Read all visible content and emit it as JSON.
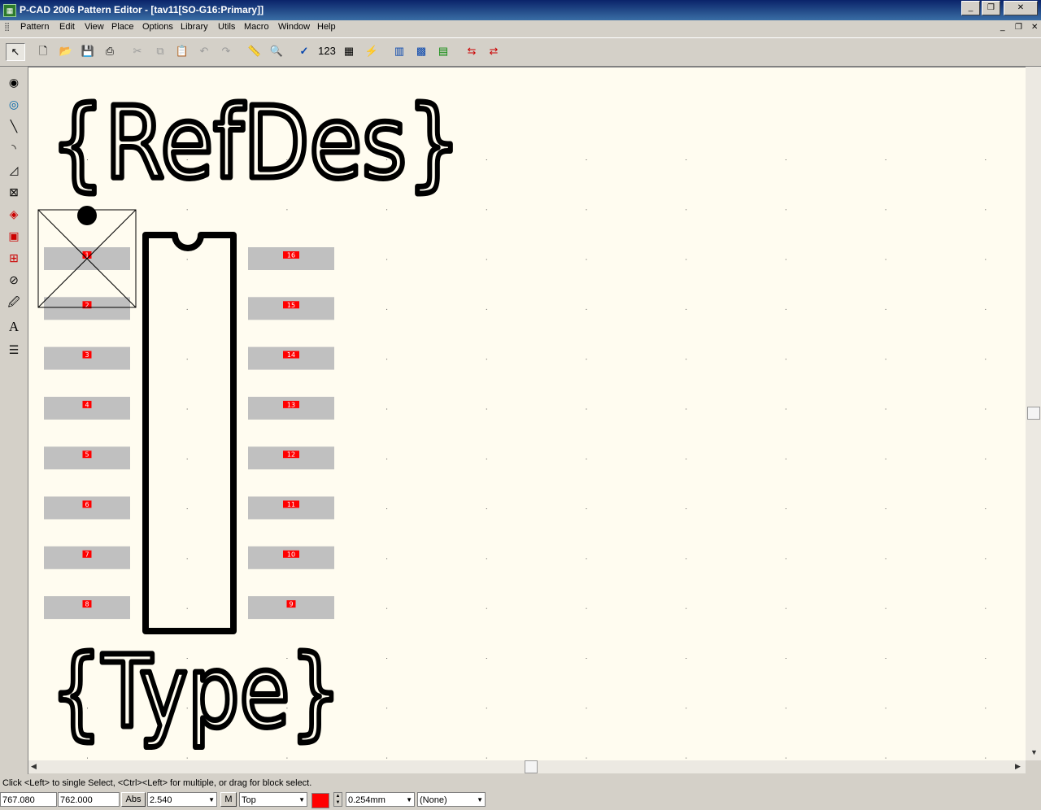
{
  "window": {
    "title": "P-CAD 2006 Pattern Editor - [tav11[SO-G16:Primary]]",
    "app_icon": "pcad-chip-icon",
    "minimize": "_",
    "restore": "❐",
    "close": "✕"
  },
  "menu": {
    "items": [
      "Pattern",
      "Edit",
      "View",
      "Place",
      "Options",
      "Library",
      "Utils",
      "Macro",
      "Window",
      "Help"
    ]
  },
  "mdi": {
    "minimize": "_",
    "restore": "❐",
    "close": "✕"
  },
  "toolbar": {
    "buttons": [
      {
        "icon": "select-arrow-icon",
        "glyph": "↖"
      },
      {
        "icon": "new-file-icon",
        "glyph": "🗋"
      },
      {
        "icon": "open-folder-icon",
        "glyph": "📂"
      },
      {
        "icon": "save-icon",
        "glyph": "💾"
      },
      {
        "icon": "print-icon",
        "glyph": "⎙"
      },
      {
        "icon": "cut-icon",
        "glyph": "✂"
      },
      {
        "icon": "copy-icon",
        "glyph": "⧉"
      },
      {
        "icon": "paste-icon",
        "glyph": "📋"
      },
      {
        "icon": "undo-icon",
        "glyph": "↶"
      },
      {
        "icon": "redo-icon",
        "glyph": "↷"
      },
      {
        "icon": "measure-ruler-icon",
        "glyph": "📏"
      },
      {
        "icon": "zoom-icon",
        "glyph": "🔍"
      },
      {
        "icon": "validate-check-icon",
        "glyph": "✓"
      },
      {
        "icon": "renumber-icon",
        "glyph": "123"
      },
      {
        "icon": "pattern-wizard-icon",
        "glyph": "▦"
      },
      {
        "icon": "flash-icon",
        "glyph": "⚡"
      },
      {
        "icon": "pad-style-icon",
        "glyph": "▥"
      },
      {
        "icon": "via-style-icon",
        "glyph": "▩"
      },
      {
        "icon": "layers-icon",
        "glyph": "▤"
      },
      {
        "icon": "flip-horizontal-icon",
        "glyph": "⇆"
      },
      {
        "icon": "flip-vertical-icon",
        "glyph": "⇄"
      }
    ]
  },
  "sidebar": {
    "tools": [
      {
        "icon": "place-pad-icon",
        "glyph": "◉"
      },
      {
        "icon": "place-via-icon",
        "glyph": "◎"
      },
      {
        "icon": "place-line-icon",
        "glyph": "╲"
      },
      {
        "icon": "place-arc-icon",
        "glyph": "◝"
      },
      {
        "icon": "place-polygon-icon",
        "glyph": "◿"
      },
      {
        "icon": "place-pattern-icon",
        "glyph": "⊠"
      },
      {
        "icon": "place-copper-pour-icon",
        "glyph": "◈"
      },
      {
        "icon": "place-cutout-icon",
        "glyph": "▣"
      },
      {
        "icon": "place-keepout-icon",
        "glyph": "⊞"
      },
      {
        "icon": "place-forbidden-icon",
        "glyph": "⊘"
      },
      {
        "icon": "place-attribute-icon",
        "glyph": "🖉"
      },
      {
        "icon": "place-text-icon",
        "glyph": "A"
      },
      {
        "icon": "place-field-icon",
        "glyph": "☰"
      }
    ]
  },
  "canvas": {
    "refdes_text": "{RefDes}",
    "type_text": "{Type}",
    "pads_left": [
      "1",
      "2",
      "3",
      "4",
      "5",
      "6",
      "7",
      "8"
    ],
    "pads_right": [
      "16",
      "15",
      "14",
      "13",
      "12",
      "11",
      "10",
      "9"
    ],
    "colors": {
      "background": "#fffcf0",
      "silkscreen": "#000000",
      "pad": "#c0c0c0",
      "pad_label": "#ff0000",
      "grid_dot": "#555555"
    }
  },
  "status": {
    "message": "Click <Left> to single Select, <Ctrl><Left> for multiple, or drag for block select.",
    "x_coord": "767.080",
    "y_coord": "762.000",
    "abs_button": "Abs",
    "grid_value": "2.540",
    "m_button": "M",
    "layer": "Top",
    "layer_color": "#ff0000",
    "line_width": "0.254mm",
    "style": "(None)"
  }
}
